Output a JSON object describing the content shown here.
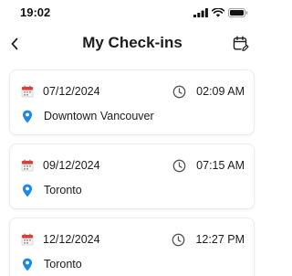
{
  "status_bar": {
    "time": "19:02",
    "icons": [
      "signal-icon",
      "wifi-icon",
      "battery-icon"
    ]
  },
  "header": {
    "back_icon": "chevron-left-icon",
    "title": "My Check-ins",
    "action_icon": "calendar-edit-icon"
  },
  "checkins": [
    {
      "date": "07/12/2024",
      "time": "02:09 AM",
      "location": "Downtown Vancouver"
    },
    {
      "date": "09/12/2024",
      "time": "07:15 AM",
      "location": "Toronto"
    },
    {
      "date": "12/12/2024",
      "time": "12:27 PM",
      "location": "Toronto"
    }
  ],
  "colors": {
    "accent_blue": "#1e88e5",
    "calendar_red": "#e53935",
    "clock_gray": "#555555"
  }
}
